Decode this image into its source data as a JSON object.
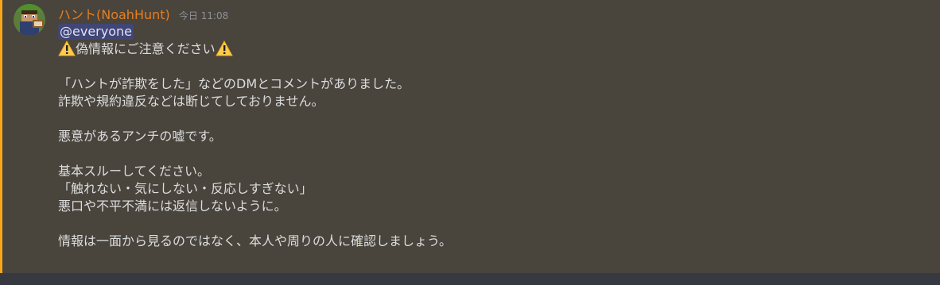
{
  "message": {
    "author": "ハント(NoahHunt)",
    "timestamp": "今日 11:08",
    "mention": "@everyone",
    "warning_text": "偽情報にご注意ください",
    "lines": {
      "l1": "「ハントが詐欺をした」などのDMとコメントがありました。",
      "l2": "詐欺や規約違反などは断じてしておりません。",
      "l3": "悪意があるアンチの嘘です。",
      "l4": "基本スルーしてください。",
      "l5": "「触れない・気にしない・反応しすぎない」",
      "l6": "悪口や不平不満には返信しないように。",
      "l7": "情報は一面から見るのではなく、本人や周りの人に確認しましょう。"
    },
    "icons": {
      "avatar": "avatar-minecraft-character",
      "warning": "warning-icon"
    }
  },
  "colors": {
    "username": "#e67e22",
    "mention_bar": "#faa61a",
    "mention_pill_bg": "#414675",
    "message_bg": "#49443c"
  }
}
